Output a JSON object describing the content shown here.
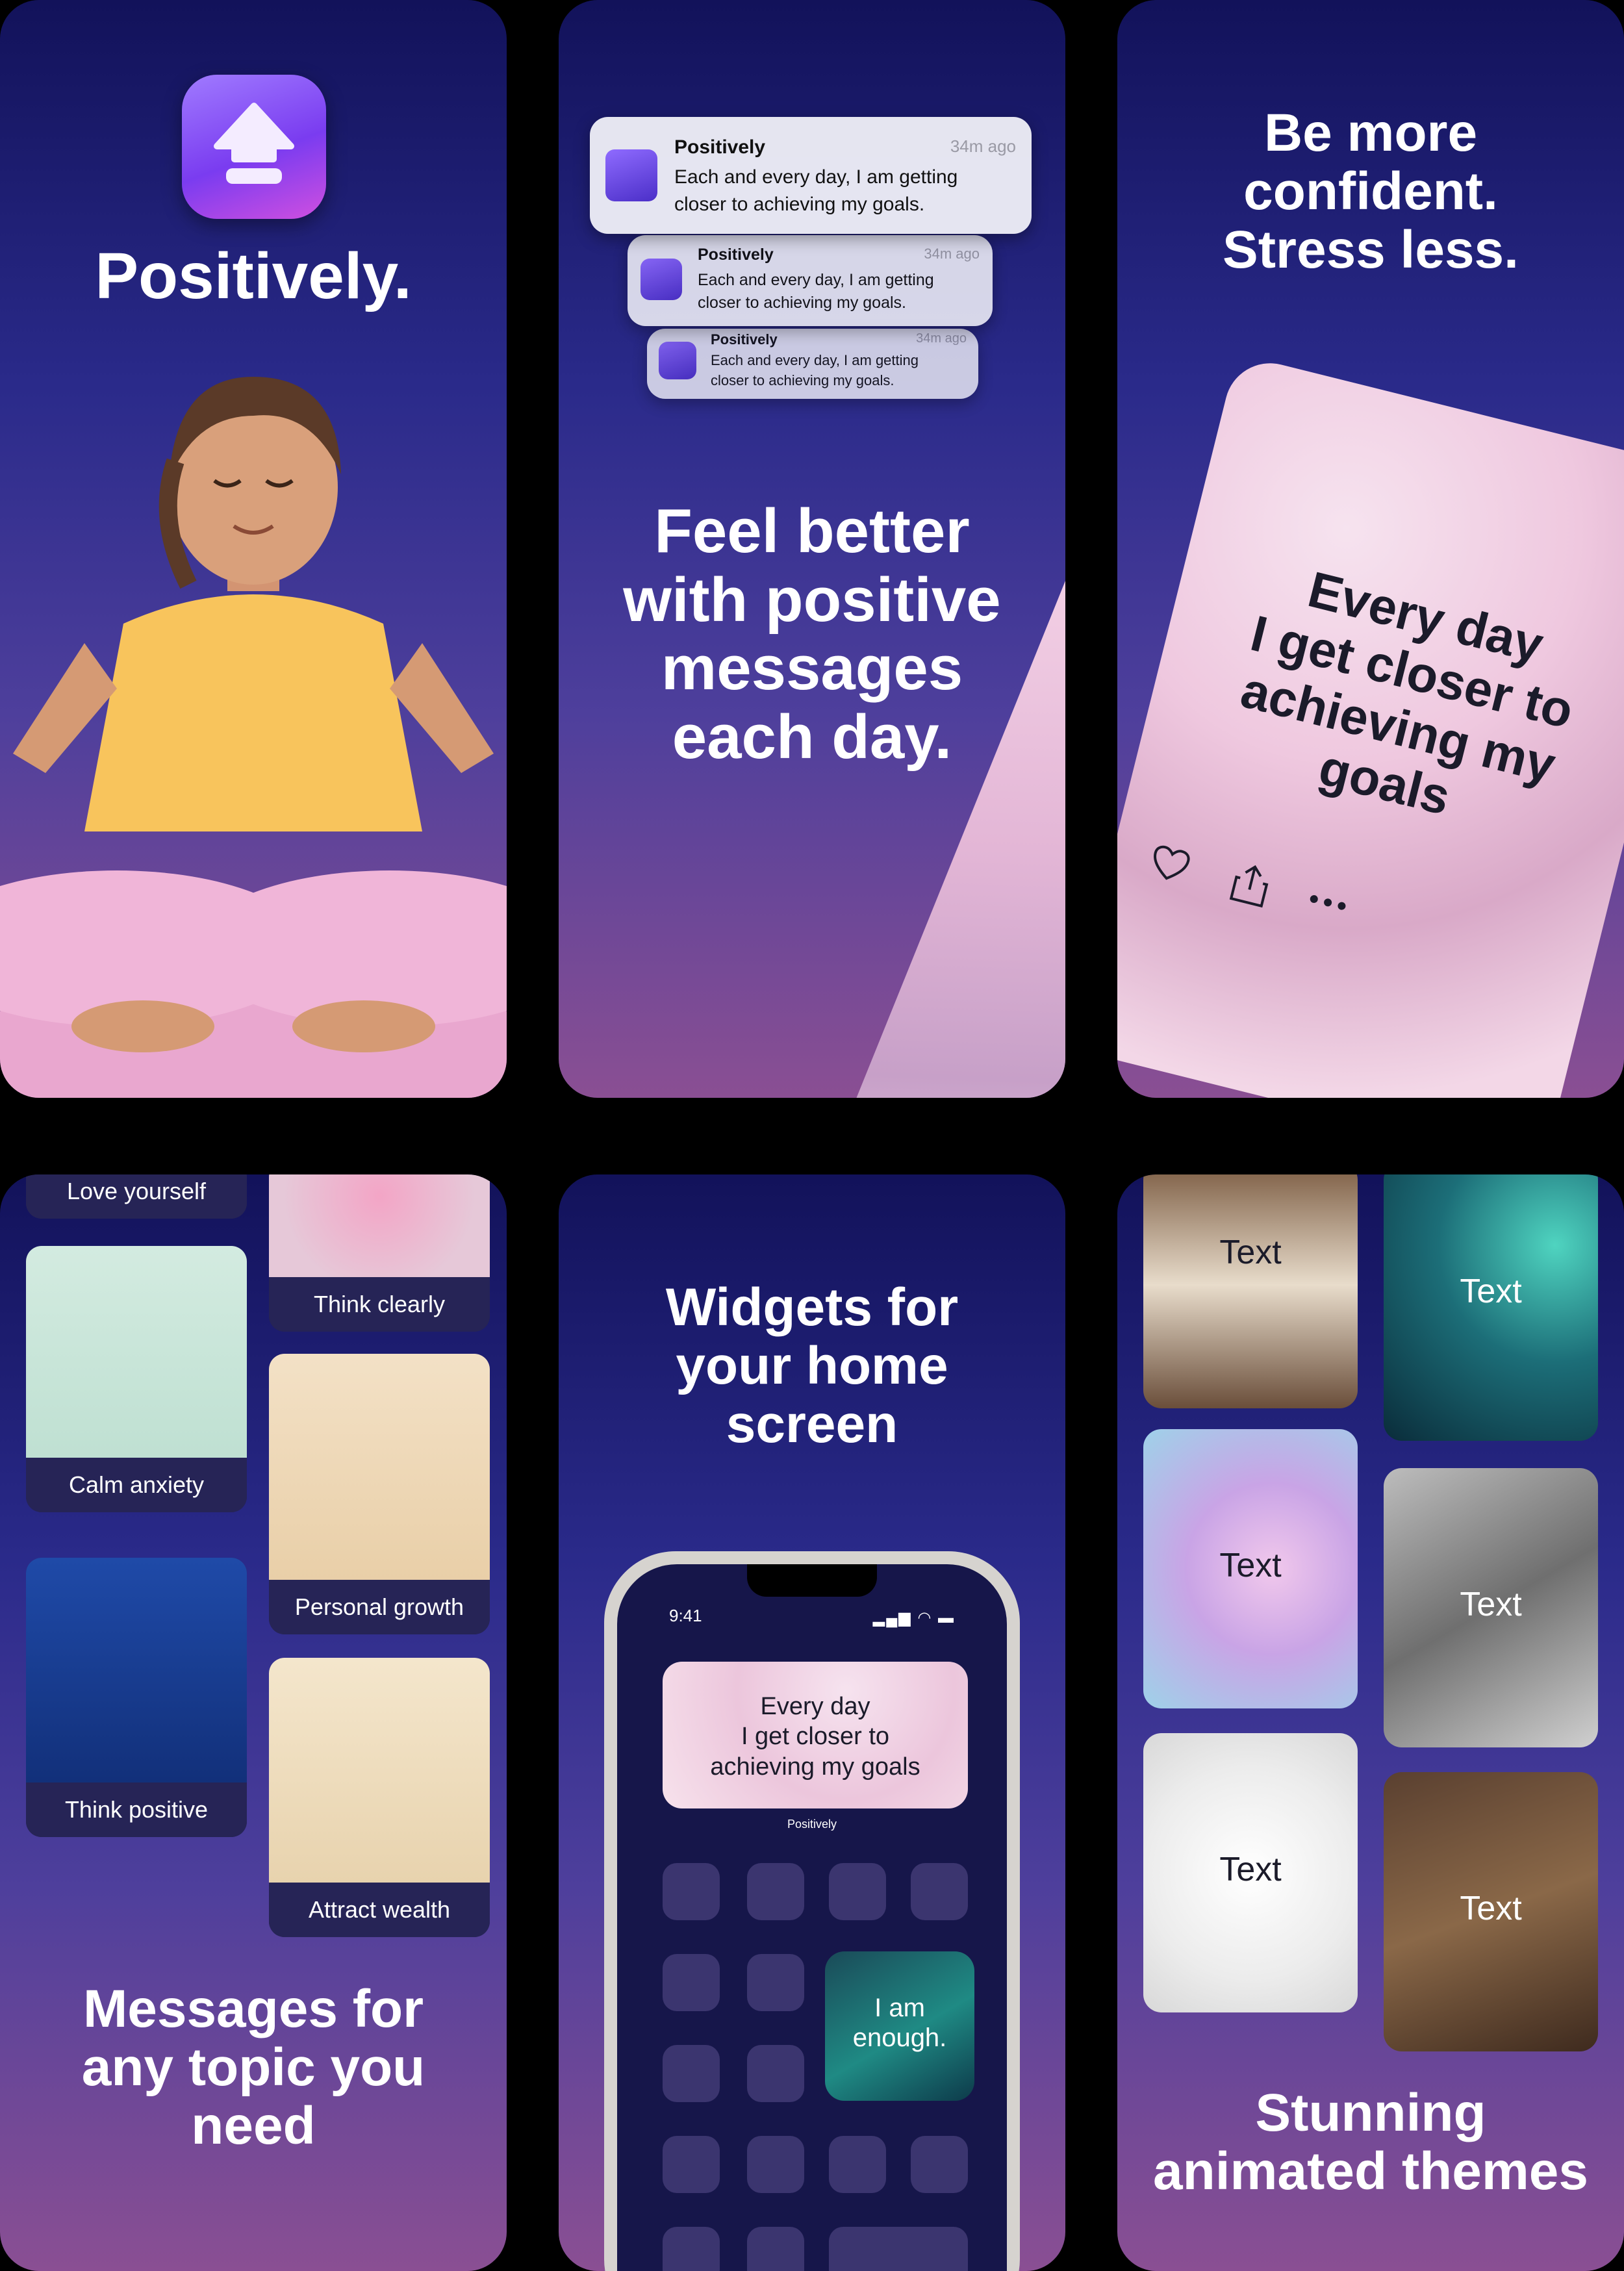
{
  "panel1": {
    "title": "Positively."
  },
  "panel2": {
    "notification": {
      "app": "Positively",
      "time": "34m ago",
      "body_line1": "Each and every day, I am getting",
      "body_line2": "closer to achieving my goals."
    },
    "headline": [
      "Feel better",
      "with positive",
      "messages",
      "each day."
    ]
  },
  "panel3": {
    "headline": [
      "Be more",
      "confident.",
      "Stress less."
    ],
    "card_text": [
      "Every day",
      "I get closer to",
      "achieving my",
      "goals"
    ]
  },
  "panel4": {
    "topics": [
      "Love yourself",
      "Think clearly",
      "Calm anxiety",
      "Personal growth",
      "Think positive",
      "Attract wealth"
    ],
    "headline": [
      "Messages for",
      "any topic you",
      "need"
    ]
  },
  "panel5": {
    "headline": [
      "Widgets for",
      "your home",
      "screen"
    ],
    "status_time": "9:41",
    "widget_text": [
      "Every day",
      "I get closer to",
      "achieving my goals"
    ],
    "widget_label": "Positively",
    "small_widget_text": [
      "I am",
      "enough."
    ]
  },
  "panel6": {
    "theme_label": "Text",
    "headline": [
      "Stunning",
      "animated themes"
    ]
  },
  "colors": {
    "accent": "#7a3cf0",
    "panel_top": "#12125a",
    "panel_bottom": "#8a4f93"
  }
}
